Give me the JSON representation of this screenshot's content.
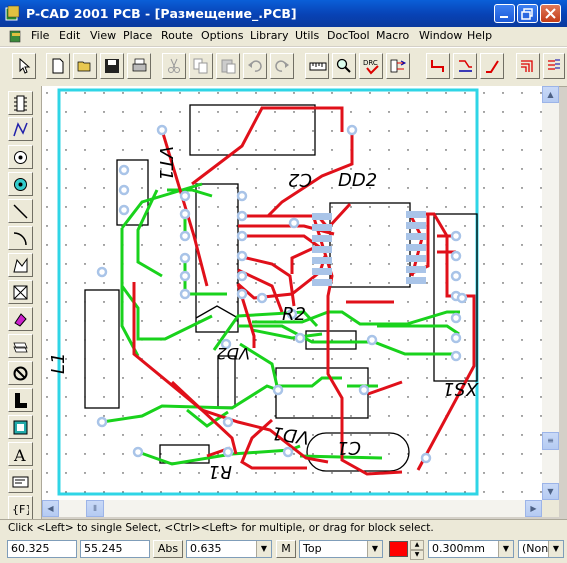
{
  "window": {
    "title": "P-CAD 2001 PCB - [Размещение_.PCB]"
  },
  "menu": [
    "File",
    "Edit",
    "View",
    "Place",
    "Route",
    "Options",
    "Library",
    "Utils",
    "DocTool",
    "Macro",
    "Window",
    "Help"
  ],
  "board": {
    "labels": {
      "c2": "C2",
      "dd2": "DD2",
      "vt1": "VT1",
      "r2": "R2",
      "l1": "L1",
      "xs1": "XS1",
      "vd1": "VD1",
      "c1": "C1",
      "r1": "R1",
      "vd2": "VD2"
    }
  },
  "status": {
    "message": "Click <Left> to single Select, <Ctrl><Left> for multiple, or drag for block select."
  },
  "bottombar": {
    "x_coord": "60.325",
    "y_coord": "55.245",
    "abs_label": "Abs",
    "grid": "0.635",
    "m_label": "M",
    "layer": "Top",
    "layer_color": "#ff0000",
    "width": "0.300mm",
    "net": "(None)"
  },
  "colors": {
    "trace_top": "#e0101a",
    "trace_bottom": "#19d21c",
    "pad": "#a9c4e8",
    "board_outline": "#2fd5e6"
  }
}
